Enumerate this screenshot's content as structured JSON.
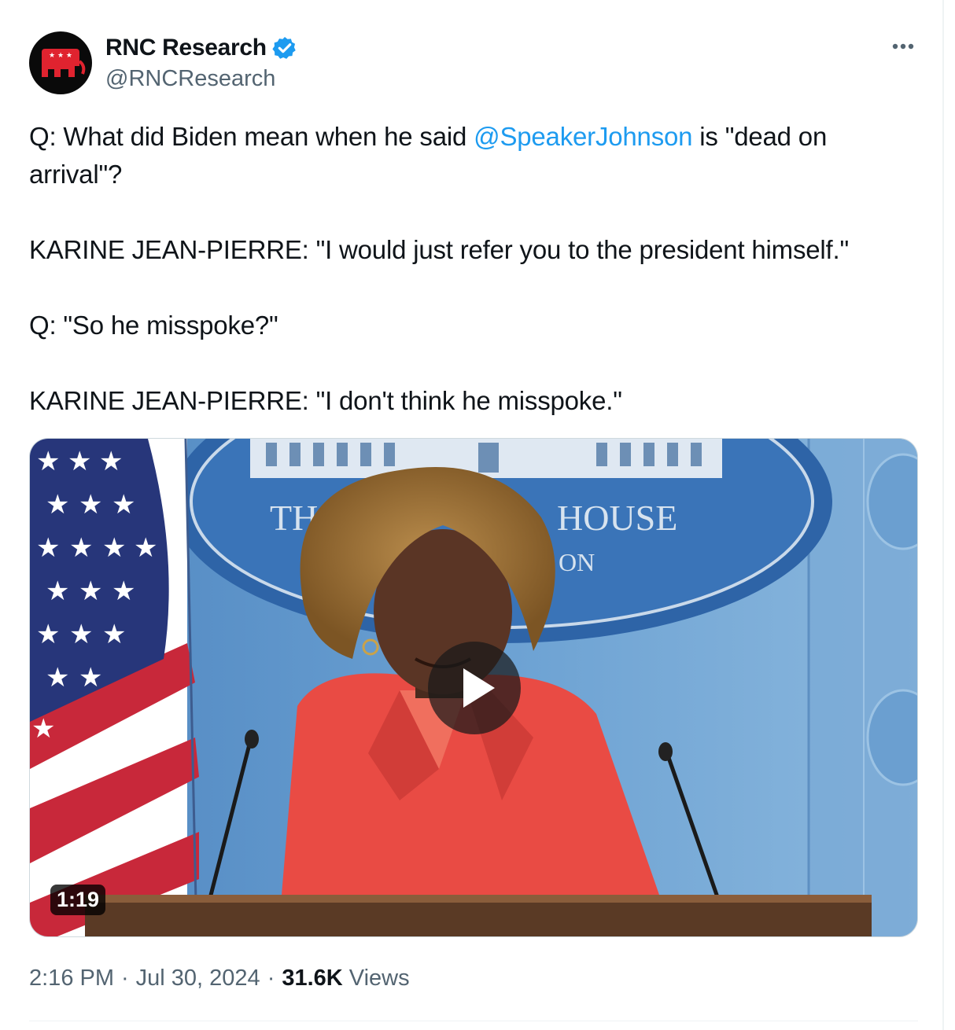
{
  "author": {
    "name": "RNC Research",
    "handle": "@RNCResearch",
    "verified": true,
    "avatar_icon": "gop-elephant-icon"
  },
  "tweet": {
    "line1_pre": "Q: What did Biden mean when he said ",
    "mention": "@SpeakerJohnson",
    "line1_post": " is \"dead on arrival\"?",
    "para2": "KARINE JEAN-PIERRE: \"I would just refer you to the president himself.\"",
    "para3": "Q: \"So he misspoke?\"",
    "para4": "KARINE JEAN-PIERRE: \"I don't think he misspoke.\""
  },
  "media": {
    "type": "video",
    "duration": "1:19",
    "backdrop_text_1": "HOUSE",
    "backdrop_text_2": "ON",
    "backdrop_text_3": "TH"
  },
  "meta": {
    "time": "2:16 PM",
    "date": "Jul 30, 2024",
    "views_count": "31.6K",
    "views_label": "Views"
  },
  "colors": {
    "link": "#1d9bf0",
    "secondary_text": "#536471",
    "verified_badge": "#1d9bf0"
  }
}
